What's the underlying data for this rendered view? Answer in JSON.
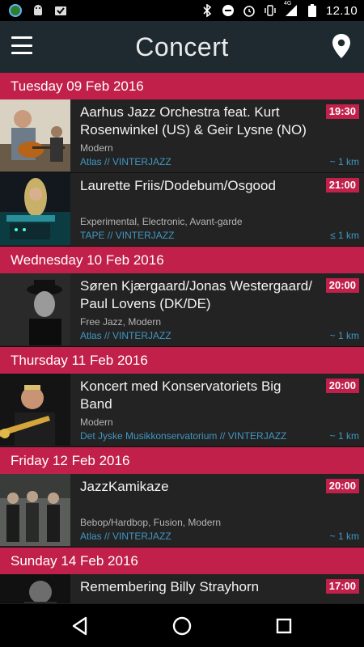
{
  "status_bar": {
    "time": "12.10",
    "network": "4G",
    "icons": [
      "globe-app-icon",
      "android-icon",
      "checkbox-app-icon",
      "bluetooth-icon",
      "do-not-disturb-icon",
      "alarm-icon",
      "vibrate-icon",
      "signal-icon",
      "battery-icon"
    ]
  },
  "header": {
    "title": "Concert",
    "menu_icon": "menu-icon",
    "action_icon": "location-pin-icon"
  },
  "colors": {
    "accent": "#c1204a",
    "link": "#3f97c2",
    "appbar": "#1f2a30",
    "background": "#1c1c1c"
  },
  "days": [
    {
      "label": "Tuesday 09 Feb 2016",
      "events": [
        {
          "title": "Aarhus Jazz Orchestra feat. Kurt Rosenwinkel (US) & Geir Lysne (NO)",
          "time": "19:30",
          "genre": "Modern",
          "venue": "Atlas // VINTERJAZZ",
          "distance": "~ 1 km"
        },
        {
          "title": "Laurette Friis/Dodebum/Osgood",
          "time": "21:00",
          "genre": "Experimental, Electronic, Avant-garde",
          "venue": "TAPE // VINTERJAZZ",
          "distance": "≤ 1 km"
        }
      ]
    },
    {
      "label": "Wednesday 10 Feb 2016",
      "events": [
        {
          "title": "Søren Kjærgaard/Jonas Westergaard/ Paul Lovens (DK/DE)",
          "time": "20:00",
          "genre": "Free Jazz, Modern",
          "venue": "Atlas // VINTERJAZZ",
          "distance": "~ 1 km"
        }
      ]
    },
    {
      "label": "Thursday 11 Feb 2016",
      "events": [
        {
          "title": "Koncert med Konservatoriets Big Band",
          "time": "20:00",
          "genre": "Modern",
          "venue": "Det Jyske Musikkonservatorium // VINTERJAZZ",
          "distance": "~ 1 km"
        }
      ]
    },
    {
      "label": "Friday 12 Feb 2016",
      "events": [
        {
          "title": "JazzKamikaze",
          "time": "20:00",
          "genre": "Bebop/Hardbop, Fusion, Modern",
          "venue": "Atlas // VINTERJAZZ",
          "distance": "~ 1 km"
        }
      ]
    },
    {
      "label": "Sunday 14 Feb 2016",
      "events": [
        {
          "title": "Remembering Billy Strayhorn",
          "time": "17:00",
          "genre": "",
          "venue": "",
          "distance": ""
        }
      ]
    }
  ],
  "nav": {
    "back": "back-icon",
    "home": "home-icon",
    "recents": "recents-icon"
  }
}
